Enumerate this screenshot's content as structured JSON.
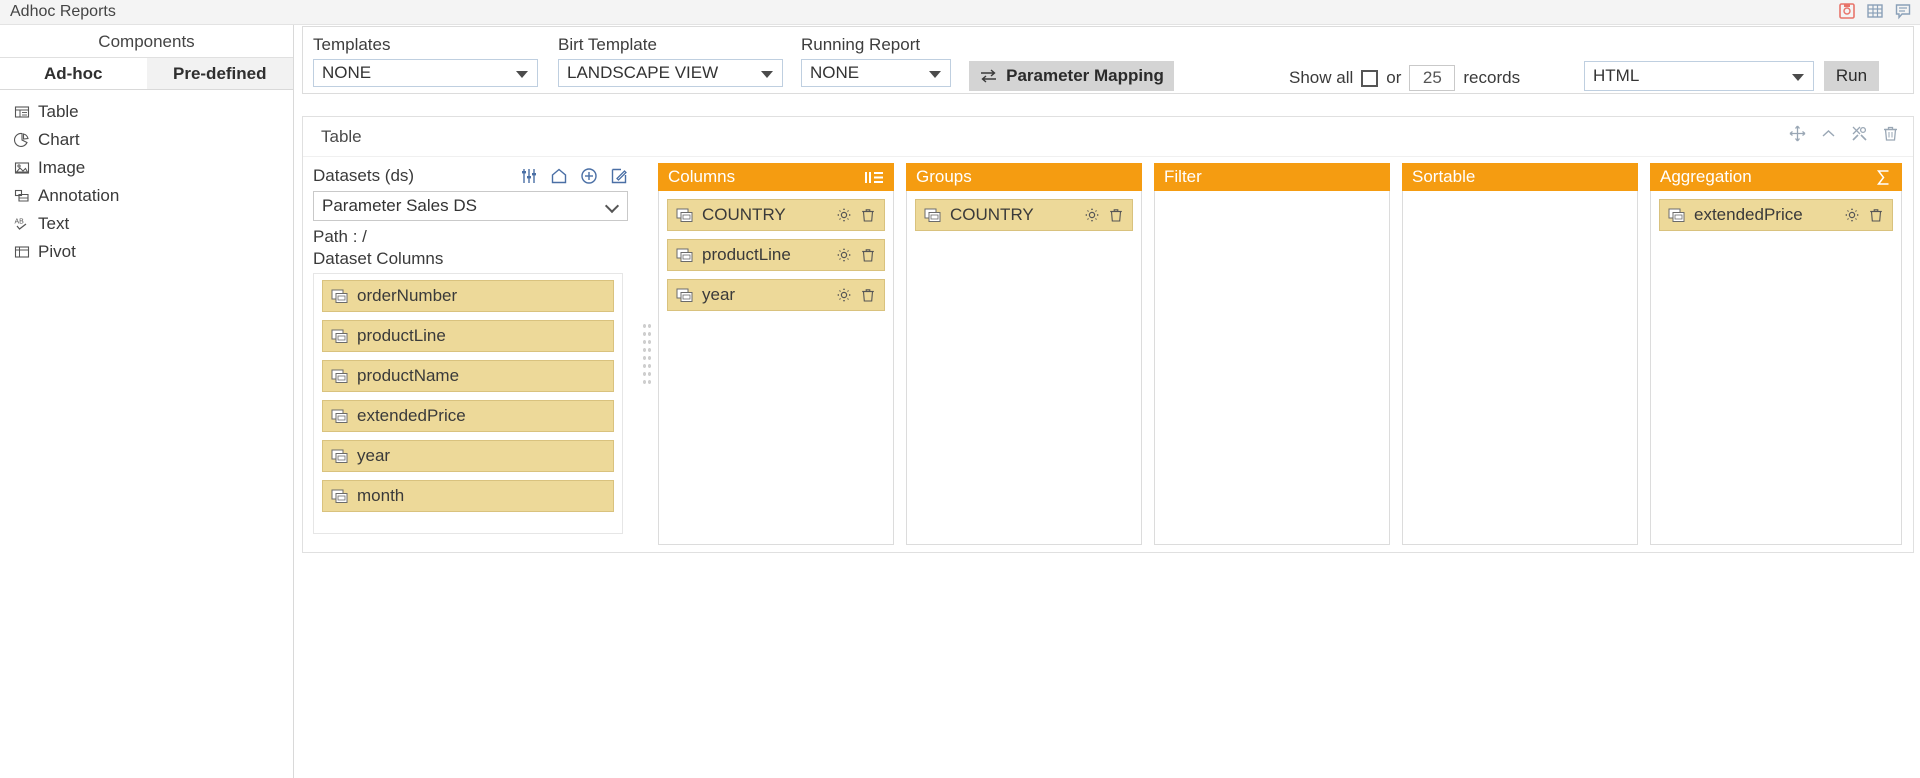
{
  "window": {
    "title": "Adhoc Reports",
    "icons": [
      {
        "name": "save-report-icon",
        "glyph": "save"
      },
      {
        "name": "table-grid-icon",
        "glyph": "grid"
      },
      {
        "name": "comment-icon",
        "glyph": "comment"
      }
    ]
  },
  "sidebar": {
    "header": "Components",
    "tabs": [
      {
        "label": "Ad-hoc",
        "active": true
      },
      {
        "label": "Pre-defined",
        "active": false
      }
    ],
    "items": [
      {
        "label": "Table",
        "icon": "table-icon"
      },
      {
        "label": "Chart",
        "icon": "chart-pie-icon"
      },
      {
        "label": "Image",
        "icon": "image-icon"
      },
      {
        "label": "Annotation",
        "icon": "annotation-icon"
      },
      {
        "label": "Text",
        "icon": "text-ab-icon"
      },
      {
        "label": "Pivot",
        "icon": "pivot-icon"
      }
    ]
  },
  "toolbar": {
    "templates": {
      "label": "Templates",
      "value": "NONE"
    },
    "birt_template": {
      "label": "Birt Template",
      "value": "LANDSCAPE VIEW"
    },
    "running_report": {
      "label": "Running Report",
      "value": "NONE"
    },
    "parameter_mapping_button": "Parameter Mapping",
    "show_all_label": "Show all",
    "or_label": "or",
    "records_value": "25",
    "records_label": "records",
    "format": {
      "value": "HTML"
    },
    "run_button": "Run"
  },
  "card": {
    "title": "Table",
    "header_icons": [
      {
        "name": "move-icon"
      },
      {
        "name": "collapse-chevron-up-icon"
      },
      {
        "name": "tools-icon"
      },
      {
        "name": "delete-trash-icon"
      }
    ]
  },
  "datasets": {
    "title": "Datasets (ds)",
    "icons": [
      {
        "name": "filter-sliders-icon"
      },
      {
        "name": "home-icon"
      },
      {
        "name": "add-circle-icon"
      },
      {
        "name": "edit-icon"
      }
    ],
    "selected": "Parameter Sales DS",
    "path": "Path : /",
    "columns_label": "Dataset Columns",
    "columns": [
      {
        "label": "orderNumber"
      },
      {
        "label": "productLine"
      },
      {
        "label": "productName"
      },
      {
        "label": "extendedPrice"
      },
      {
        "label": "year"
      },
      {
        "label": "month"
      }
    ]
  },
  "panels": [
    {
      "title": "Columns",
      "header_icon": "list-lines-icon",
      "items": [
        {
          "label": "COUNTRY"
        },
        {
          "label": "productLine"
        },
        {
          "label": "year"
        }
      ]
    },
    {
      "title": "Groups",
      "header_icon": "none",
      "items": [
        {
          "label": "COUNTRY"
        }
      ]
    },
    {
      "title": "Filter",
      "header_icon": "none",
      "items": []
    },
    {
      "title": "Sortable",
      "header_icon": "none",
      "items": []
    },
    {
      "title": "Aggregation",
      "header_icon": "sigma-icon",
      "items": [
        {
          "label": "extendedPrice"
        }
      ]
    }
  ],
  "colors": {
    "panel_header": "#f59c11",
    "chip_bg": "#edd999",
    "chip_border": "#d9c27e",
    "button_grey": "#d4d4d4"
  }
}
